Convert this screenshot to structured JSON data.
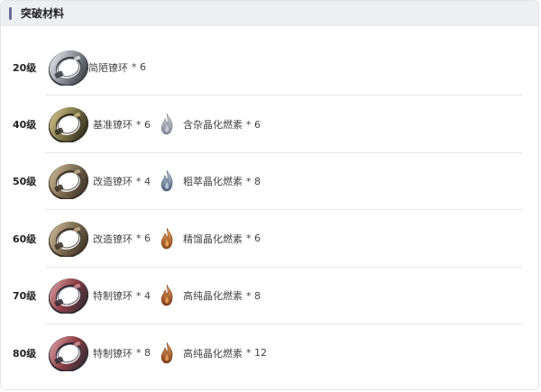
{
  "section": {
    "title": "突破材料"
  },
  "rows": [
    {
      "level": "20级",
      "ring": {
        "icon": "silver-ring-icon",
        "name": "简陋镣环",
        "qty": "* 6",
        "style": "silver"
      },
      "fuel": null
    },
    {
      "level": "40级",
      "ring": {
        "icon": "gold-ring-icon",
        "name": "基准镣环",
        "qty": "* 6",
        "style": "gold"
      },
      "fuel": {
        "icon": "grey-flame-icon",
        "name": "含杂晶化燃素",
        "qty": "* 6",
        "style": "grey"
      }
    },
    {
      "level": "50级",
      "ring": {
        "icon": "bronze-ring-icon",
        "name": "改造镣环",
        "qty": "* 4",
        "style": "bronze"
      },
      "fuel": {
        "icon": "blue-flame-icon",
        "name": "粗萃晶化燃素",
        "qty": "* 8",
        "style": "blue"
      }
    },
    {
      "level": "60级",
      "ring": {
        "icon": "bronze-ring-icon",
        "name": "改造镣环",
        "qty": "* 6",
        "style": "bronze"
      },
      "fuel": {
        "icon": "orange-flame-icon",
        "name": "精馏晶化燃素",
        "qty": "* 6",
        "style": "orange"
      }
    },
    {
      "level": "70级",
      "ring": {
        "icon": "red-ring-icon",
        "name": "特制镣环",
        "qty": "* 4",
        "style": "red"
      },
      "fuel": {
        "icon": "amber-flame-icon",
        "name": "高纯晶化燃素",
        "qty": "* 8",
        "style": "amber"
      }
    },
    {
      "level": "80级",
      "ring": {
        "icon": "red-ring-icon",
        "name": "特制镣环",
        "qty": "* 8",
        "style": "red"
      },
      "fuel": {
        "icon": "amber-flame-icon",
        "name": "高纯晶化燃素",
        "qty": "* 12",
        "style": "amber"
      }
    }
  ],
  "colors": {
    "header_bg": "#eeeff3",
    "accent": "#6a6d9c",
    "divider": "#e8e8ee",
    "ring": {
      "silver": [
        "#e2e4e8",
        "#8a8f98",
        "#3a3d44"
      ],
      "gold": [
        "#cfc089",
        "#7d7448",
        "#2f2c1e"
      ],
      "bronze": [
        "#c9b693",
        "#7d6c52",
        "#3b3125"
      ],
      "red": [
        "#d89a9e",
        "#8e3f45",
        "#2e2a35"
      ]
    },
    "flame": {
      "grey": [
        "#d6d9df",
        "#7f858f"
      ],
      "blue": [
        "#c8d6e6",
        "#4d6078"
      ],
      "orange": [
        "#f0b061",
        "#8a4418"
      ],
      "amber": [
        "#f2a65e",
        "#7a3a1c"
      ]
    }
  }
}
